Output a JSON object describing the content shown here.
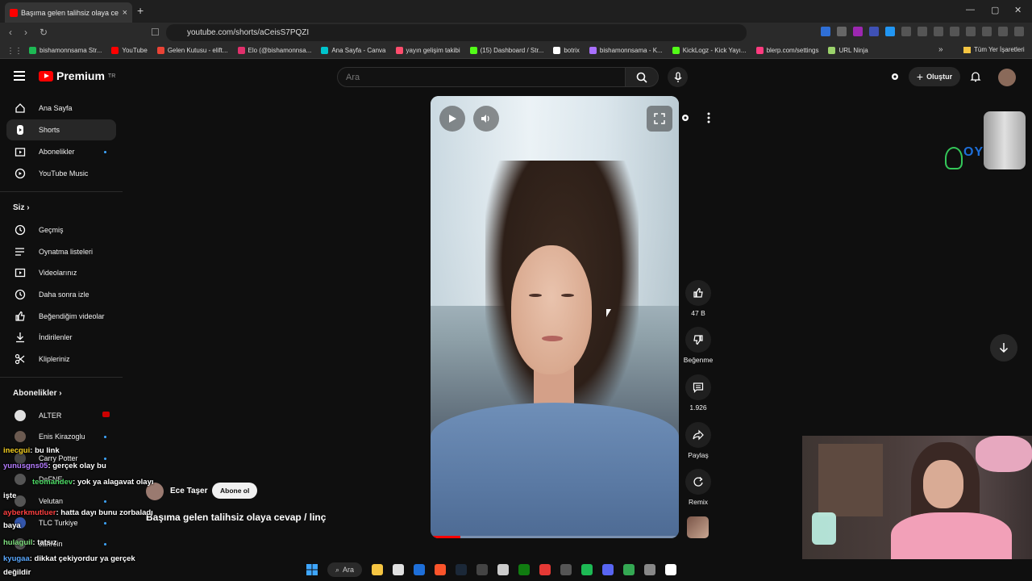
{
  "browser": {
    "tab_title": "Başıma gelen talihsiz olaya ce",
    "tab_close": "×",
    "new_tab": "+",
    "url": "youtube.com/shorts/aCeisS7PQZI",
    "window_controls": [
      "—",
      "▢",
      "✕"
    ],
    "bookmarks": [
      {
        "label": "bishamonnsama Str...",
        "color": "#1db954"
      },
      {
        "label": "YouTube",
        "color": "#ff0000"
      },
      {
        "label": "Gelen Kutusu - elift...",
        "color": "#ea4335"
      },
      {
        "label": "Elo (@bishamonnsa...",
        "color": "#e1306c"
      },
      {
        "label": "Ana Sayfa - Canva",
        "color": "#00c4cc"
      },
      {
        "label": "yayın gelişim takibi",
        "color": "#ff4d6d"
      },
      {
        "label": "(15) Dashboard / Str...",
        "color": "#53fc18"
      },
      {
        "label": "botrix",
        "color": "#ffffff"
      },
      {
        "label": "bishamonnsama - K...",
        "color": "#a970ff"
      },
      {
        "label": "KickLogz - Kick Yayı...",
        "color": "#53fc18"
      },
      {
        "label": "blerp.com/settings",
        "color": "#ff3b7f"
      },
      {
        "label": "URL Ninja",
        "color": "#9bd26b"
      }
    ],
    "bookmarks_more": "»",
    "all_bookmarks": "Tüm Yer İşaretleri"
  },
  "header": {
    "logo_text": "Premium",
    "logo_sup": "TR",
    "search_placeholder": "Ara",
    "create_label": "Oluştur"
  },
  "sidebar": {
    "main": [
      {
        "label": "Ana Sayfa",
        "icon": "home-icon"
      },
      {
        "label": "Shorts",
        "icon": "shorts-icon",
        "active": true
      },
      {
        "label": "Abonelikler",
        "icon": "subscriptions-icon",
        "dot": true
      },
      {
        "label": "YouTube Music",
        "icon": "music-icon"
      }
    ],
    "you_heading": "Siz",
    "you": [
      {
        "label": "Geçmiş",
        "icon": "history-icon"
      },
      {
        "label": "Oynatma listeleri",
        "icon": "playlists-icon"
      },
      {
        "label": "Videolarınız",
        "icon": "your-videos-icon"
      },
      {
        "label": "Daha sonra izle",
        "icon": "watch-later-icon"
      },
      {
        "label": "Beğendiğim videolar",
        "icon": "liked-icon"
      },
      {
        "label": "İndirilenler",
        "icon": "downloads-icon"
      },
      {
        "label": "Klipleriniz",
        "icon": "clips-icon"
      }
    ],
    "subs_heading": "Abonelikler",
    "subs": [
      {
        "label": "ALTER",
        "color": "#e0e0e0",
        "live": true
      },
      {
        "label": "Enis Kirazoglu",
        "color": "#6b5a50",
        "dot": true
      },
      {
        "label": "Carry Potter",
        "color": "#444",
        "dot": true
      },
      {
        "label": "DeFNE",
        "color": "#555",
        "dot": false
      },
      {
        "label": "Velutan",
        "color": "#555",
        "dot": true
      },
      {
        "label": "TLC Turkiye",
        "color": "#3355aa",
        "dot": true
      },
      {
        "label": "Jahrein",
        "color": "#555",
        "dot": true
      }
    ]
  },
  "short": {
    "channel": "Ece Taşer",
    "subscribe": "Abone ol",
    "title": "Başıma gelen talihsiz olaya cevap / linç",
    "progress": 0.12,
    "actions": [
      {
        "label": "47 B",
        "icon": "like-icon"
      },
      {
        "label": "Beğenme",
        "icon": "dislike-icon"
      },
      {
        "label": "1.926",
        "icon": "comment-icon"
      },
      {
        "label": "Paylaş",
        "icon": "share-icon"
      },
      {
        "label": "Remix",
        "icon": "remix-icon"
      }
    ]
  },
  "chat": [
    {
      "user": "inecgui",
      "color": "#f5d020",
      "msg": ": bu link"
    },
    {
      "user": "yunusgns05",
      "color": "#b57cff",
      "msg": ": gerçek olay bu"
    },
    {
      "user": "teomandev",
      "color": "#4cd964",
      "msg": ": yok ya alagavat olayı"
    },
    {
      "user": "",
      "color": "#fff",
      "msg": "işte"
    },
    {
      "user": "ayberkmutluer",
      "color": "#ff4040",
      "msg": ": hatta dayı bunu zorbaladı"
    },
    {
      "user": "",
      "color": "#fff",
      "msg": "baya"
    },
    {
      "user": "hulaguil",
      "color": "#7fe07f",
      "msg": ": tatsız"
    },
    {
      "user": "kyugaa",
      "color": "#5aa9ff",
      "msg": ": dikkat çekiyordur ya gerçek"
    },
    {
      "user": "",
      "color": "#fff",
      "msg": "değildir"
    }
  ],
  "overlay_brand": "OY",
  "taskbar": {
    "search_label": "Ara",
    "apps": [
      "#3ea6ff",
      "#f5c542",
      "#e0e0e0",
      "#1e6fd9",
      "#fb542b",
      "#1b2838",
      "#444",
      "#ccc",
      "#107c10",
      "#e53935",
      "#555",
      "#1db954",
      "#5865f2",
      "#34a853",
      "#888",
      "#fff"
    ]
  }
}
